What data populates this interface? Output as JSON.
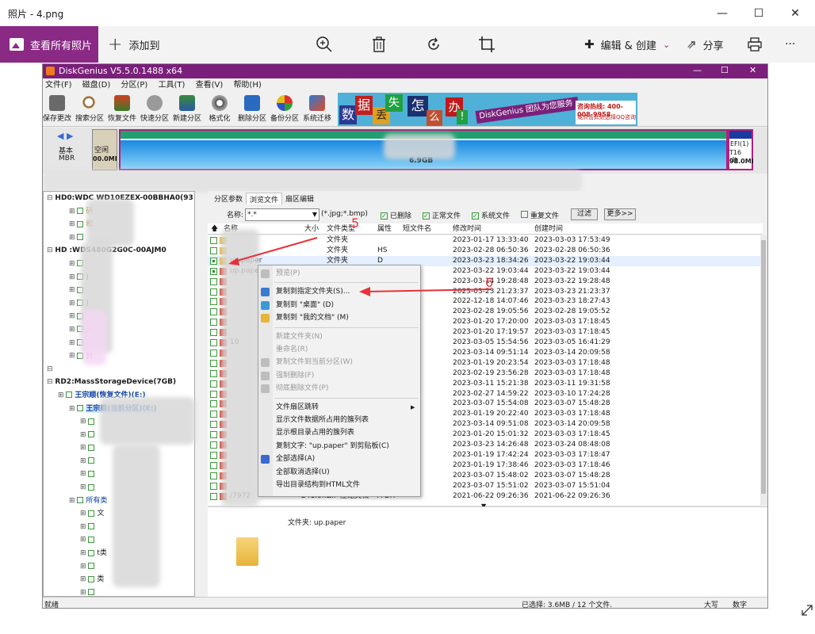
{
  "viewer": {
    "title": "照片 - 4.png",
    "view_all": "查看所有照片",
    "add_to": "添加到",
    "edit_create": "编辑 & 创建",
    "share": "分享",
    "more": "···"
  },
  "app": {
    "title": "DiskGenius V5.5.0.1488 x64",
    "menu": [
      "文件(F)",
      "磁盘(D)",
      "分区(P)",
      "工具(T)",
      "查看(V)",
      "帮助(H)"
    ],
    "toolbar": [
      "保存更改",
      "搜索分区",
      "恢复文件",
      "快速分区",
      "新建分区",
      "格式化",
      "删除分区",
      "备份分区",
      "系统迁移"
    ],
    "banner": {
      "chars": [
        "数",
        "据",
        "丢",
        "失",
        "怎",
        "么",
        "办",
        "!"
      ],
      "slogan": "DiskGenius 团队为您服务",
      "phone": "咨询热线: 400-008-9958",
      "qq": "或点击此处选择QQ咨询"
    }
  },
  "diskbar": {
    "disk_type": "基本",
    "disk_scheme": "MBR",
    "free_label": "空闲",
    "free_size": "00.0MI",
    "main_size": "6.9GB",
    "efi_label": "EFI(1)",
    "efi_fs": "T16 (隐",
    "efi_size": "98.0MI"
  },
  "tree": [
    {
      "text": "HD0:WDC WD10EZEX-00BBHA0(93",
      "indent": 0,
      "bold": true
    },
    {
      "text": "研",
      "indent": 2,
      "color": "#9a6000"
    },
    {
      "text": "和",
      "indent": 2,
      "color": "#9a6000"
    },
    {
      "text": "",
      "indent": 2
    },
    {
      "text": "HD    :WDS480G2G0C-00AJM0",
      "indent": 0,
      "bold": true
    },
    {
      "text": "",
      "indent": 2
    },
    {
      "text": ")",
      "indent": 2
    },
    {
      "text": "",
      "indent": 2
    },
    {
      "text": ")",
      "indent": 2
    },
    {
      "text": "",
      "indent": 2
    },
    {
      "text": "分",
      "indent": 2,
      "color": "#a020a0"
    },
    {
      "text": "分",
      "indent": 2,
      "color": "#a020a0"
    },
    {
      "text": "分",
      "indent": 2,
      "color": "#a020a0"
    },
    {
      "text": "",
      "indent": 0
    },
    {
      "text": "RD2:MassStorageDevice(7GB)",
      "indent": 0,
      "bold": true
    },
    {
      "text": "王宗顺(恢复文件)(E:)",
      "indent": 1,
      "color": "#0a40a0",
      "bold": true
    },
    {
      "text": "王宗顺(当前分区)(E:)",
      "indent": 2,
      "color": "#0a40a0",
      "bold": true,
      "selected": true
    },
    {
      "text": "",
      "indent": 3
    },
    {
      "text": "",
      "indent": 3
    },
    {
      "text": "",
      "indent": 3
    },
    {
      "text": "",
      "indent": 3
    },
    {
      "text": "",
      "indent": 3
    },
    {
      "text": "",
      "indent": 3
    },
    {
      "text": "所有类",
      "indent": 2,
      "color": "#0a40a0"
    },
    {
      "text": "文",
      "indent": 3
    },
    {
      "text": "",
      "indent": 3
    },
    {
      "text": "",
      "indent": 3
    },
    {
      "text": "t类",
      "indent": 3
    },
    {
      "text": "",
      "indent": 3
    },
    {
      "text": "类",
      "indent": 3
    },
    {
      "text": "",
      "indent": 3
    },
    {
      "text": "可移动磁盘(已识别)(?)",
      "indent": 2,
      "color": "#0a40a0"
    }
  ],
  "tabs": [
    "分区参数",
    "浏览文件",
    "扇区编辑"
  ],
  "filter": {
    "name_label": "名称:",
    "name_value": "*.*",
    "ext_hint": "(*.jpg;*.bmp)",
    "checks": [
      "已删除",
      "正常文件",
      "系统文件",
      "重复文件"
    ],
    "filter_button": "过滤",
    "more_button": "更多>>"
  },
  "columns": [
    "名称",
    "大小",
    "文件类型",
    "属性",
    "短文件名",
    "修改时间",
    "创建时间"
  ],
  "rows": [
    {
      "name": "",
      "size": "",
      "type": "文件夹",
      "attr": "",
      "short": "",
      "mtime": "2023-01-17 13:33:40",
      "ctime": "2023-03-03 17:53:49",
      "checked": false
    },
    {
      "name": "",
      "size": "",
      "type": "文件夹",
      "attr": "HS",
      "short": "",
      "mtime": "2023-02-28 06:50:36",
      "ctime": "2023-02-28 06:50:36",
      "checked": false
    },
    {
      "name": "up.paper",
      "size": "",
      "type": "文件夹",
      "attr": "D",
      "short": "",
      "mtime": "2023-03-23 18:34:26",
      "ctime": "2023-03-22 19:03:44",
      "checked": true
    },
    {
      "name": "up.paper",
      "size": "",
      "type": "",
      "attr": "",
      "short": "",
      "mtime": "2023-03-22 19:03:44",
      "ctime": "2023-03-22 19:03:44",
      "checked": true
    },
    {
      "name": "",
      "size": "",
      "type": "",
      "attr": "",
      "short": "",
      "mtime": "2023-03-14 19:28:48",
      "ctime": "2023-03-22 19:28:48",
      "checked": false
    },
    {
      "name": "",
      "size": "",
      "type": "",
      "attr": "",
      "short": "",
      "mtime": "2023-03-23 21:23:37",
      "ctime": "2023-03-23 21:23:37",
      "checked": false
    },
    {
      "name": "",
      "size": "",
      "type": "",
      "attr": "",
      "short": "",
      "mtime": "2022-12-18 14:07:46",
      "ctime": "2023-03-23 18:27:43",
      "checked": false
    },
    {
      "name": "",
      "size": "",
      "type": "",
      "attr": "",
      "short": "",
      "mtime": "2023-02-28 19:05:56",
      "ctime": "2023-02-28 19:05:52",
      "checked": false
    },
    {
      "name": "",
      "size": "",
      "type": "",
      "attr": "",
      "short": "",
      "mtime": "2023-01-20 17:20:00",
      "ctime": "2023-03-03 17:18:45",
      "checked": false
    },
    {
      "name": "",
      "size": "",
      "type": "",
      "attr": "",
      "short": "",
      "mtime": "2023-01-20 17:19:57",
      "ctime": "2023-03-03 17:18:45",
      "checked": false
    },
    {
      "name": "10",
      "size": "",
      "type": "",
      "attr": "",
      "short": "",
      "mtime": "2023-03-05 15:54:56",
      "ctime": "2023-03-05 16:41:29",
      "checked": false
    },
    {
      "name": "",
      "size": "",
      "type": "",
      "attr": "",
      "short": "",
      "mtime": "2023-03-14 09:51:14",
      "ctime": "2023-03-14 20:09:58",
      "checked": false
    },
    {
      "name": "",
      "size": "",
      "type": "",
      "attr": "",
      "short": "",
      "mtime": "2023-01-19 20:23:54",
      "ctime": "2023-03-03 17:18:48",
      "checked": false
    },
    {
      "name": "",
      "size": "",
      "type": "",
      "attr": "",
      "short": "",
      "mtime": "2023-02-19 23:56:28",
      "ctime": "2023-03-03 17:18:48",
      "checked": false
    },
    {
      "name": "",
      "size": "",
      "type": "",
      "attr": "",
      "short": "",
      "mtime": "2023-03-11 15:21:38",
      "ctime": "2023-03-11 19:31:58",
      "checked": false
    },
    {
      "name": "",
      "size": "",
      "type": "",
      "attr": "",
      "short": "",
      "mtime": "2023-02-27 14:59:22",
      "ctime": "2023-03-10 17:24:28",
      "checked": false
    },
    {
      "name": "",
      "size": "",
      "type": "",
      "attr": "",
      "short": "",
      "mtime": "2023-03-07 15:54:08",
      "ctime": "2023-03-07 15:48:28",
      "checked": false
    },
    {
      "name": "",
      "size": "",
      "type": "",
      "attr": "",
      "short": "",
      "mtime": "2023-01-19 20:22:40",
      "ctime": "2023-03-03 17:18:48",
      "checked": false
    },
    {
      "name": "",
      "size": "",
      "type": "",
      "attr": "",
      "short": "",
      "mtime": "2023-03-14 09:51:08",
      "ctime": "2023-03-14 20:09:58",
      "checked": false
    },
    {
      "name": "",
      "size": "",
      "type": "",
      "attr": "",
      "short": "",
      "mtime": "2023-01-20 15:01:32",
      "ctime": "2023-03-03 17:18:45",
      "checked": false
    },
    {
      "name": "",
      "size": "",
      "type": "",
      "attr": "",
      "short": "",
      "mtime": "2023-03-23 14:26:48",
      "ctime": "2023-03-24 08:48:08",
      "checked": false
    },
    {
      "name": "",
      "size": "",
      "type": "",
      "attr": "",
      "short": "",
      "mtime": "2023-01-19 17:42:24",
      "ctime": "2023-03-03 17:18:47",
      "checked": false
    },
    {
      "name": "",
      "size": "",
      "type": "",
      "attr": "",
      "short": "",
      "mtime": "2023-01-19 17:38:46",
      "ctime": "2023-03-03 17:18:46",
      "checked": false
    },
    {
      "name": "",
      "size": "",
      "type": "",
      "attr": "",
      "short": "",
      "mtime": "2023-03-07 15:48:02",
      "ctime": "2023-03-07 15:48:28",
      "checked": false
    },
    {
      "name": "",
      "size": "",
      "type": "",
      "attr": "",
      "short": "",
      "mtime": "2023-03-07 15:51:02",
      "ctime": "2023-03-07 15:51:04",
      "checked": false
    },
    {
      "name": "/7972",
      "size": "241.8...",
      "type": "ZIP 压缩文档",
      "attr": "A DX",
      "short": "",
      "mtime": "2021-06-22 09:26:36",
      "ctime": "2021-06-22 09:26:36",
      "checked": false
    }
  ],
  "preview": {
    "folder_label": "文件夹: up.paper"
  },
  "context_menu": [
    {
      "label": "预览(P)",
      "disabled": true,
      "icon": "preview-icon",
      "sep_after": true
    },
    {
      "label": "复制到指定文件夹(S)...",
      "disabled": false,
      "icon": "copy-folder-icon"
    },
    {
      "label": "复制到 \"桌面\" (D)",
      "disabled": false,
      "icon": "desktop-icon"
    },
    {
      "label": "复制到 \"我的文档\" (M)",
      "disabled": false,
      "icon": "documents-icon",
      "sep_after": true
    },
    {
      "label": "新建文件夹(N)",
      "disabled": true
    },
    {
      "label": "重命名(R)",
      "disabled": true
    },
    {
      "label": "复制文件到当前分区(W)",
      "disabled": true,
      "icon": "copy-partition-icon"
    },
    {
      "label": "强制删除(F)",
      "disabled": true,
      "icon": "force-delete-icon"
    },
    {
      "label": "彻底删除文件(P)",
      "disabled": true,
      "icon": "wipe-icon",
      "sep_after": true
    },
    {
      "label": "文件扇区跳转",
      "disabled": false,
      "submenu": true
    },
    {
      "label": "显示文件数据所占用的簇列表",
      "disabled": false
    },
    {
      "label": "显示根目录占用的簇列表",
      "disabled": false
    },
    {
      "label": "复制文字: \"up.paper\" 到剪贴板(C)",
      "disabled": false
    },
    {
      "label": "全部选择(A)",
      "disabled": false,
      "icon": "check-icon"
    },
    {
      "label": "全部取消选择(U)",
      "disabled": false
    },
    {
      "label": "导出目录结构到HTML文件",
      "disabled": false
    }
  ],
  "annotations": {
    "step5": "5",
    "step6": "6"
  },
  "status": {
    "left": "就绪",
    "selected": "已选择: 3.6MB / 12 个文件.",
    "caps": "大写",
    "num": "数字"
  },
  "colors": {
    "accent": "#8a2a85",
    "dg_title": "#7a1f7a",
    "arrow": "#e8313a"
  }
}
